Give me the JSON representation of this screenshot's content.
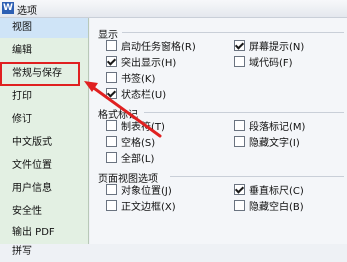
{
  "window": {
    "title": "选项",
    "icon": "app-logo-icon"
  },
  "sidebar": {
    "items": [
      {
        "label": "视图",
        "selected": true
      },
      {
        "label": "编辑",
        "selected": false
      },
      {
        "label": "常规与保存",
        "selected": false
      },
      {
        "label": "打印",
        "selected": false
      },
      {
        "label": "修订",
        "selected": false
      },
      {
        "label": "中文版式",
        "selected": false
      },
      {
        "label": "文件位置",
        "selected": false
      },
      {
        "label": "用户信息",
        "selected": false
      },
      {
        "label": "安全性",
        "selected": false
      },
      {
        "label": "输出 PDF",
        "selected": false
      },
      {
        "label": "拼写",
        "selected": false
      }
    ]
  },
  "sections": {
    "display": {
      "title": "显示",
      "options": [
        {
          "label": "启动任务窗格(R)",
          "checked": false
        },
        {
          "label": "屏幕提示(N)",
          "checked": true
        },
        {
          "label": "突出显示(H)",
          "checked": true
        },
        {
          "label": "域代码(F)",
          "checked": false
        },
        {
          "label": "书签(K)",
          "checked": false
        },
        {
          "label": "状态栏(U)",
          "checked": true
        }
      ]
    },
    "format_marks": {
      "title": "格式标记",
      "options": [
        {
          "label": "制表符(T)",
          "checked": false
        },
        {
          "label": "段落标记(M)",
          "checked": false
        },
        {
          "label": "空格(S)",
          "checked": false
        },
        {
          "label": "隐藏文字(I)",
          "checked": false
        },
        {
          "label": "全部(L)",
          "checked": false
        }
      ]
    },
    "page_view": {
      "title": "页面视图选项",
      "options": [
        {
          "label": "对象位置(J)",
          "checked": false
        },
        {
          "label": "垂直标尺(C)",
          "checked": true
        },
        {
          "label": "正文边框(X)",
          "checked": false
        },
        {
          "label": "隐藏空白(B)",
          "checked": false
        }
      ]
    }
  },
  "colors": {
    "highlight": "#e02020",
    "sidebar_bg": "#e3f0e3",
    "selected_bg": "#cfe4f7"
  }
}
